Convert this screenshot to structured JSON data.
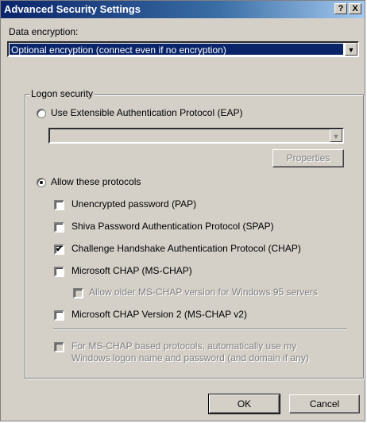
{
  "window": {
    "title": "Advanced Security Settings",
    "help_glyph": "?",
    "close_glyph": "X"
  },
  "encryption": {
    "label": "Data encryption:",
    "value": "Optional encryption (connect even if no encryption)"
  },
  "logon": {
    "group_label": "Logon security",
    "eap_label": "Use Extensible Authentication Protocol (EAP)",
    "eap_combo_value": "",
    "properties_label": "Properties",
    "allow_label": "Allow these protocols",
    "protocols": [
      {
        "label": "Unencrypted password (PAP)",
        "checked": false
      },
      {
        "label": "Shiva Password Authentication Protocol (SPAP)",
        "checked": false
      },
      {
        "label": "Challenge Handshake Authentication Protocol (CHAP)",
        "checked": true
      },
      {
        "label": "Microsoft CHAP (MS-CHAP)",
        "checked": false
      }
    ],
    "older_mschap_label": "Allow older MS-CHAP version for Windows 95 servers",
    "mschap_v2_label": "Microsoft CHAP Version 2 (MS-CHAP v2)",
    "auto_logon_label_line1": "For MS-CHAP based protocols, automatically use my",
    "auto_logon_label_line2": "Windows logon name and password (and domain if any)"
  },
  "buttons": {
    "ok": "OK",
    "cancel": "Cancel"
  },
  "icons": {
    "dropdown": "▼",
    "check": "✔"
  }
}
